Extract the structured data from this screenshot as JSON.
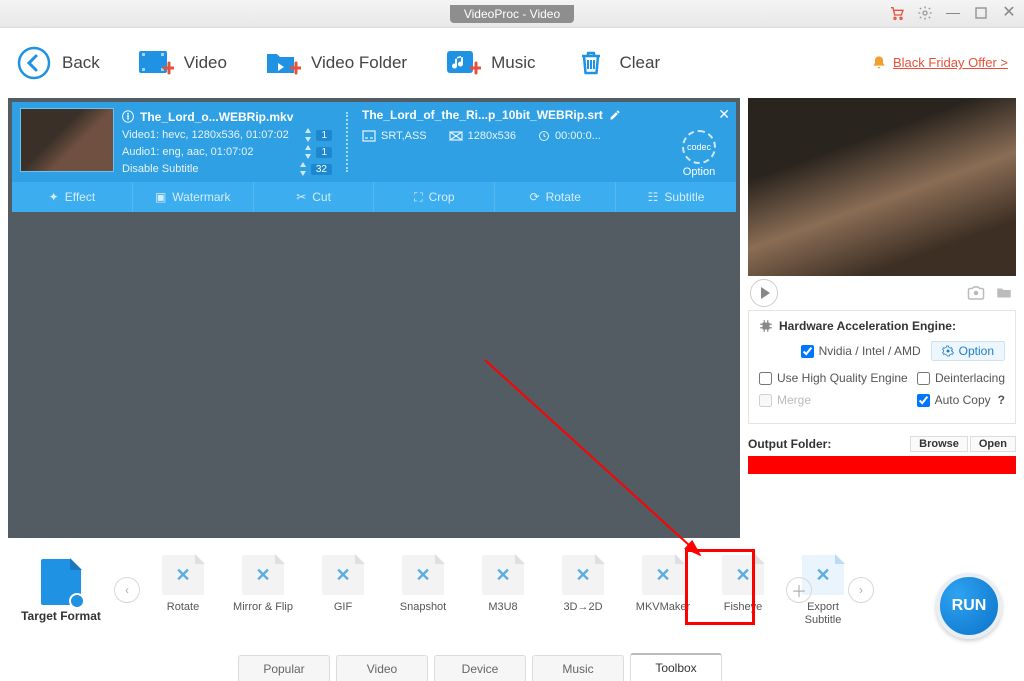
{
  "titlebar": {
    "title": "VideoProc - Video"
  },
  "toolbar": {
    "back": "Back",
    "video": "Video",
    "video_folder": "Video Folder",
    "music": "Music",
    "clear": "Clear",
    "offer": "Black Friday Offer >"
  },
  "file_card": {
    "source_title": "The_Lord_o...WEBRip.mkv",
    "video_line": "Video1: hevc, 1280x536, 01:07:02",
    "audio_line": "Audio1: eng, aac, 01:07:02",
    "subtitle_line": "Disable Subtitle",
    "video_badge": "1",
    "audio_badge": "1",
    "subtitle_badge": "32",
    "srt_title": "The_Lord_of_the_Ri...p_10bit_WEBRip.srt",
    "srt_format": "SRT,ASS",
    "srt_res": "1280x536",
    "srt_time": "00:00:0...",
    "option_label": "Option",
    "option_gear": "codec",
    "tools": {
      "effect": "Effect",
      "watermark": "Watermark",
      "cut": "Cut",
      "crop": "Crop",
      "rotate": "Rotate",
      "subtitle": "Subtitle"
    }
  },
  "hw": {
    "title": "Hardware Acceleration Engine:",
    "gpu": "Nvidia / Intel / AMD",
    "option_btn": "Option",
    "use_hq": "Use High Quality Engine",
    "deint": "Deinterlacing",
    "merge": "Merge",
    "autocopy": "Auto Copy"
  },
  "output": {
    "label": "Output Folder:",
    "browse": "Browse",
    "open": "Open"
  },
  "target_format": {
    "label": "Target Format"
  },
  "toolbox": {
    "items": [
      {
        "label": "Rotate"
      },
      {
        "label": "Mirror & Flip"
      },
      {
        "label": "GIF"
      },
      {
        "label": "Snapshot"
      },
      {
        "label": "M3U8"
      },
      {
        "label": "3D→2D"
      },
      {
        "label": "MKVMaker"
      },
      {
        "label": "Fisheye"
      },
      {
        "label": "Export Subtitle"
      }
    ]
  },
  "cats": {
    "popular": "Popular",
    "video": "Video",
    "device": "Device",
    "music": "Music",
    "toolbox": "Toolbox"
  },
  "run": "RUN"
}
